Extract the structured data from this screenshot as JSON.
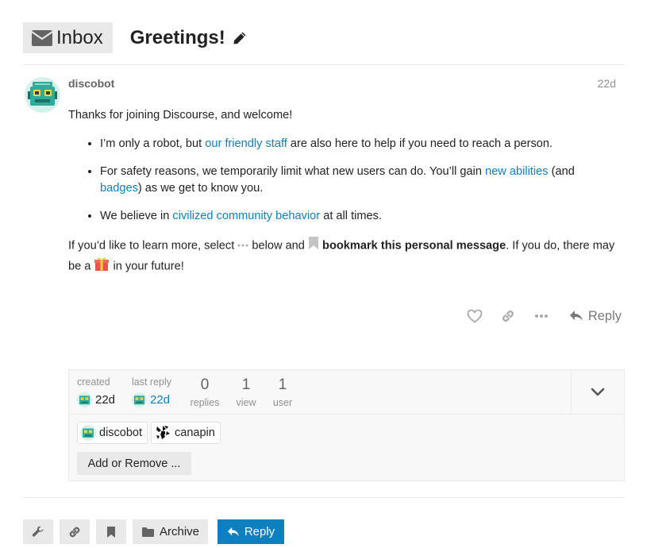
{
  "header": {
    "inbox_label": "Inbox",
    "title": "Greetings!"
  },
  "post": {
    "username": "discobot",
    "date": "22d",
    "intro": "Thanks for joining Discourse, and welcome!",
    "bullets": [
      {
        "before": "I’m only a robot, but ",
        "link": "our friendly staff",
        "after": " are also here to help if you need to reach a person."
      },
      {
        "before": "For safety reasons, we temporarily limit what new users can do. You’ll gain ",
        "link": "new abilities",
        "middle": " (and ",
        "link2": "badges",
        "after": ") as we get to know you."
      },
      {
        "before": "We believe in ",
        "link": "civilized community behavior",
        "after": " at all times."
      }
    ],
    "outro": {
      "part1": "If you’d like to learn more, select ",
      "part2": " below and ",
      "bold": "bookmark this personal message",
      "part3": ". If you do, there may be a ",
      "part4": " in your future!"
    },
    "actions": {
      "reply_label": "Reply",
      "icons": [
        "heart-icon",
        "link-icon",
        "ellipsis-icon",
        "reply-icon"
      ]
    }
  },
  "topic_map": {
    "created_label": "created",
    "created_value": "22d",
    "last_reply_label": "last reply",
    "last_reply_value": "22d",
    "replies_count": "0",
    "replies_label": "replies",
    "views_count": "1",
    "views_label": "view",
    "users_count": "1",
    "users_label": "user",
    "participants": [
      "discobot",
      "canapin"
    ],
    "add_remove_label": "Add or Remove ..."
  },
  "footer": {
    "archive_label": "Archive",
    "reply_label": "Reply",
    "icons": [
      "wrench-icon",
      "link-icon",
      "bookmark-icon",
      "folder-icon",
      "reply-icon"
    ]
  },
  "colors": {
    "link": "#0e7fbf",
    "primary": "#0e7fbf",
    "button_bg": "#e9e9e9",
    "avatar_teal": "#2dac9c"
  }
}
